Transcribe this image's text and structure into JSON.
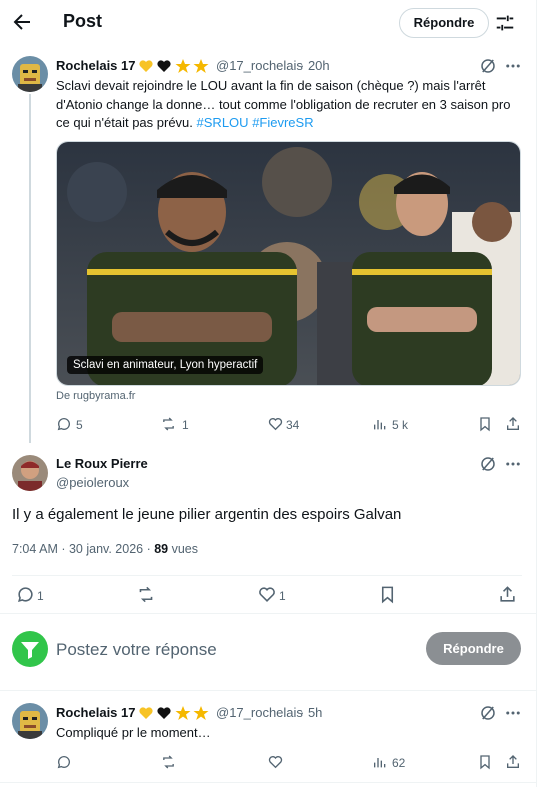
{
  "header": {
    "title": "Post",
    "reply_button": "Répondre"
  },
  "tweet1": {
    "name": "Rochelais 17",
    "handle": "@17_rochelais",
    "time": "· 20h",
    "text_main": "Sclavi devait rejoindre le LOU avant la fin de saison (chèque ?) mais l'arrêt d'Atonio change la donne… tout comme l'obligation de recruter en 3 saison pro ce qui n'était pas prévu.",
    "hashtag1": "#SRLOU",
    "hashtag2": "#FievreSR",
    "media_caption": "Sclavi en animateur, Lyon hyperactif",
    "source": "De rugbyrama.fr",
    "replies": "5",
    "reposts": "1",
    "likes": "34",
    "views": "5 k"
  },
  "tweet2": {
    "name": "Le Roux Pierre",
    "handle": "@peioleroux",
    "text": "Il y a également le jeune pilier argentin des espoirs Galvan",
    "timestamp": "7:04 AM · 30 janv. 2026 · ",
    "views_count": "89",
    "views_label": " vues",
    "replies": "1",
    "likes": "1"
  },
  "composer": {
    "placeholder": "Postez votre réponse",
    "button": "Répondre"
  },
  "tweet3": {
    "name": "Rochelais 17",
    "handle": "@17_rochelais",
    "time": "· 5h",
    "text": "Compliqué pr le moment…",
    "views": "62"
  },
  "colors": {
    "accent": "#1d9bf0",
    "composer_avatar": "#31c54a",
    "reply_button_disabled": "#8b8f93",
    "star": "#f5b800",
    "heart_yellow": "#f7c325"
  }
}
